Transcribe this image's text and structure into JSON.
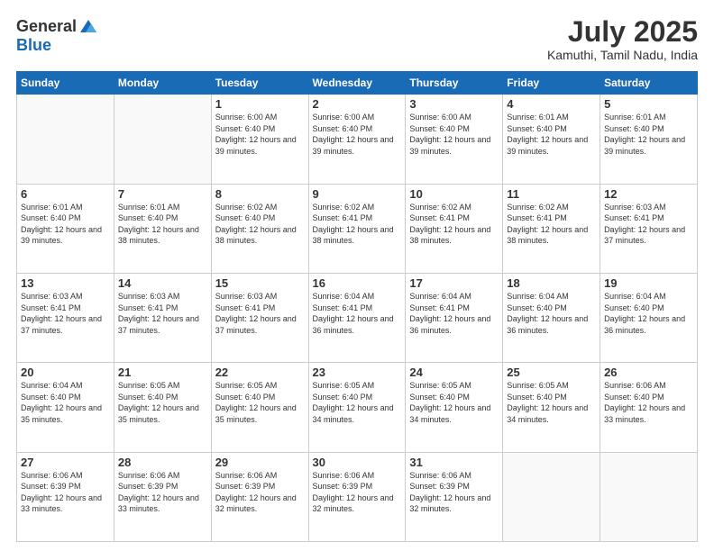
{
  "logo": {
    "general": "General",
    "blue": "Blue"
  },
  "header": {
    "month": "July 2025",
    "location": "Kamuthi, Tamil Nadu, India"
  },
  "weekdays": [
    "Sunday",
    "Monday",
    "Tuesday",
    "Wednesday",
    "Thursday",
    "Friday",
    "Saturday"
  ],
  "weeks": [
    [
      {
        "day": "",
        "sunrise": "",
        "sunset": "",
        "daylight": ""
      },
      {
        "day": "",
        "sunrise": "",
        "sunset": "",
        "daylight": ""
      },
      {
        "day": "1",
        "sunrise": "Sunrise: 6:00 AM",
        "sunset": "Sunset: 6:40 PM",
        "daylight": "Daylight: 12 hours and 39 minutes."
      },
      {
        "day": "2",
        "sunrise": "Sunrise: 6:00 AM",
        "sunset": "Sunset: 6:40 PM",
        "daylight": "Daylight: 12 hours and 39 minutes."
      },
      {
        "day": "3",
        "sunrise": "Sunrise: 6:00 AM",
        "sunset": "Sunset: 6:40 PM",
        "daylight": "Daylight: 12 hours and 39 minutes."
      },
      {
        "day": "4",
        "sunrise": "Sunrise: 6:01 AM",
        "sunset": "Sunset: 6:40 PM",
        "daylight": "Daylight: 12 hours and 39 minutes."
      },
      {
        "day": "5",
        "sunrise": "Sunrise: 6:01 AM",
        "sunset": "Sunset: 6:40 PM",
        "daylight": "Daylight: 12 hours and 39 minutes."
      }
    ],
    [
      {
        "day": "6",
        "sunrise": "Sunrise: 6:01 AM",
        "sunset": "Sunset: 6:40 PM",
        "daylight": "Daylight: 12 hours and 39 minutes."
      },
      {
        "day": "7",
        "sunrise": "Sunrise: 6:01 AM",
        "sunset": "Sunset: 6:40 PM",
        "daylight": "Daylight: 12 hours and 38 minutes."
      },
      {
        "day": "8",
        "sunrise": "Sunrise: 6:02 AM",
        "sunset": "Sunset: 6:40 PM",
        "daylight": "Daylight: 12 hours and 38 minutes."
      },
      {
        "day": "9",
        "sunrise": "Sunrise: 6:02 AM",
        "sunset": "Sunset: 6:41 PM",
        "daylight": "Daylight: 12 hours and 38 minutes."
      },
      {
        "day": "10",
        "sunrise": "Sunrise: 6:02 AM",
        "sunset": "Sunset: 6:41 PM",
        "daylight": "Daylight: 12 hours and 38 minutes."
      },
      {
        "day": "11",
        "sunrise": "Sunrise: 6:02 AM",
        "sunset": "Sunset: 6:41 PM",
        "daylight": "Daylight: 12 hours and 38 minutes."
      },
      {
        "day": "12",
        "sunrise": "Sunrise: 6:03 AM",
        "sunset": "Sunset: 6:41 PM",
        "daylight": "Daylight: 12 hours and 37 minutes."
      }
    ],
    [
      {
        "day": "13",
        "sunrise": "Sunrise: 6:03 AM",
        "sunset": "Sunset: 6:41 PM",
        "daylight": "Daylight: 12 hours and 37 minutes."
      },
      {
        "day": "14",
        "sunrise": "Sunrise: 6:03 AM",
        "sunset": "Sunset: 6:41 PM",
        "daylight": "Daylight: 12 hours and 37 minutes."
      },
      {
        "day": "15",
        "sunrise": "Sunrise: 6:03 AM",
        "sunset": "Sunset: 6:41 PM",
        "daylight": "Daylight: 12 hours and 37 minutes."
      },
      {
        "day": "16",
        "sunrise": "Sunrise: 6:04 AM",
        "sunset": "Sunset: 6:41 PM",
        "daylight": "Daylight: 12 hours and 36 minutes."
      },
      {
        "day": "17",
        "sunrise": "Sunrise: 6:04 AM",
        "sunset": "Sunset: 6:41 PM",
        "daylight": "Daylight: 12 hours and 36 minutes."
      },
      {
        "day": "18",
        "sunrise": "Sunrise: 6:04 AM",
        "sunset": "Sunset: 6:40 PM",
        "daylight": "Daylight: 12 hours and 36 minutes."
      },
      {
        "day": "19",
        "sunrise": "Sunrise: 6:04 AM",
        "sunset": "Sunset: 6:40 PM",
        "daylight": "Daylight: 12 hours and 36 minutes."
      }
    ],
    [
      {
        "day": "20",
        "sunrise": "Sunrise: 6:04 AM",
        "sunset": "Sunset: 6:40 PM",
        "daylight": "Daylight: 12 hours and 35 minutes."
      },
      {
        "day": "21",
        "sunrise": "Sunrise: 6:05 AM",
        "sunset": "Sunset: 6:40 PM",
        "daylight": "Daylight: 12 hours and 35 minutes."
      },
      {
        "day": "22",
        "sunrise": "Sunrise: 6:05 AM",
        "sunset": "Sunset: 6:40 PM",
        "daylight": "Daylight: 12 hours and 35 minutes."
      },
      {
        "day": "23",
        "sunrise": "Sunrise: 6:05 AM",
        "sunset": "Sunset: 6:40 PM",
        "daylight": "Daylight: 12 hours and 34 minutes."
      },
      {
        "day": "24",
        "sunrise": "Sunrise: 6:05 AM",
        "sunset": "Sunset: 6:40 PM",
        "daylight": "Daylight: 12 hours and 34 minutes."
      },
      {
        "day": "25",
        "sunrise": "Sunrise: 6:05 AM",
        "sunset": "Sunset: 6:40 PM",
        "daylight": "Daylight: 12 hours and 34 minutes."
      },
      {
        "day": "26",
        "sunrise": "Sunrise: 6:06 AM",
        "sunset": "Sunset: 6:40 PM",
        "daylight": "Daylight: 12 hours and 33 minutes."
      }
    ],
    [
      {
        "day": "27",
        "sunrise": "Sunrise: 6:06 AM",
        "sunset": "Sunset: 6:39 PM",
        "daylight": "Daylight: 12 hours and 33 minutes."
      },
      {
        "day": "28",
        "sunrise": "Sunrise: 6:06 AM",
        "sunset": "Sunset: 6:39 PM",
        "daylight": "Daylight: 12 hours and 33 minutes."
      },
      {
        "day": "29",
        "sunrise": "Sunrise: 6:06 AM",
        "sunset": "Sunset: 6:39 PM",
        "daylight": "Daylight: 12 hours and 32 minutes."
      },
      {
        "day": "30",
        "sunrise": "Sunrise: 6:06 AM",
        "sunset": "Sunset: 6:39 PM",
        "daylight": "Daylight: 12 hours and 32 minutes."
      },
      {
        "day": "31",
        "sunrise": "Sunrise: 6:06 AM",
        "sunset": "Sunset: 6:39 PM",
        "daylight": "Daylight: 12 hours and 32 minutes."
      },
      {
        "day": "",
        "sunrise": "",
        "sunset": "",
        "daylight": ""
      },
      {
        "day": "",
        "sunrise": "",
        "sunset": "",
        "daylight": ""
      }
    ]
  ]
}
